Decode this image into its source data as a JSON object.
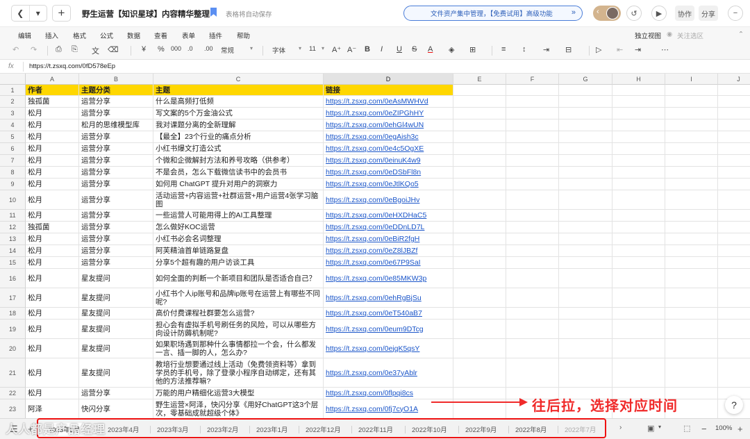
{
  "titlebar": {
    "title": "野生运营【知识星球】内容精华整理",
    "autosave": "表格将自动保存",
    "promo": "文件资产集中管理，【免费试用】高级功能",
    "collab_label": "协作",
    "share_label": "分享",
    "back_icon": "chevron-left-icon",
    "history_icon": "history-icon",
    "play_icon": "play-icon"
  },
  "menu": {
    "items": [
      "编辑",
      "插入",
      "格式",
      "公式",
      "数据",
      "查看",
      "表单",
      "插件",
      "帮助"
    ],
    "view_label": "独立视图",
    "follow_label": "关注选区"
  },
  "toolbar": {
    "number_format": "常规",
    "font_name": "字体",
    "font_size": "11"
  },
  "formula": {
    "fx_label": "fx",
    "value": "https://t.zsxq.com/0fD578eEp"
  },
  "columns": [
    "A",
    "B",
    "C",
    "D",
    "E",
    "F",
    "G",
    "H",
    "I",
    "J"
  ],
  "table": {
    "rows": [
      {
        "n": "1",
        "a": "作者",
        "b": "主题分类",
        "c": "主题",
        "d": "链接"
      },
      {
        "n": "2",
        "a": "独孤菌",
        "b": "运营分享",
        "c": "什么是高频打低频",
        "d": "https://t.zsxq.com/0eAsMWHVd"
      },
      {
        "n": "3",
        "a": "松月",
        "b": "运营分享",
        "c": "写文案的5个万金油公式",
        "d": "https://t.zsxq.com/0eZIPGhHY"
      },
      {
        "n": "4",
        "a": "松月",
        "b": "松月的思维模型库",
        "c": "我对课题分离的全新理解",
        "d": "https://t.zsxq.com/0ehGl4wUN"
      },
      {
        "n": "5",
        "a": "松月",
        "b": "运营分享",
        "c": "【最全】23个行业的痛点分析",
        "d": "https://t.zsxq.com/0egAish3c"
      },
      {
        "n": "6",
        "a": "松月",
        "b": "运营分享",
        "c": "小红书爆文打造公式",
        "d": "https://t.zsxq.com/0e4c5OgXE"
      },
      {
        "n": "7",
        "a": "松月",
        "b": "运营分享",
        "c": "个微和企微解封方法和养号攻略（供参考）",
        "d": "https://t.zsxq.com/0einuK4w9"
      },
      {
        "n": "8",
        "a": "松月",
        "b": "运营分享",
        "c": "不是会员，怎么下载微信读书中的会员书",
        "d": "https://t.zsxq.com/0eDSbFl8n"
      },
      {
        "n": "9",
        "a": "松月",
        "b": "运营分享",
        "c": "如何用 ChatGPT 提升对用户的洞察力",
        "d": "https://t.zsxq.com/0eJtlKQo5"
      },
      {
        "n": "10",
        "a": "松月",
        "b": "运营分享",
        "c": "活动运营+内容运营+社群运营+用户运营4张学习脑图",
        "d": "https://t.zsxq.com/0eBgoiJHv"
      },
      {
        "n": "11",
        "a": "松月",
        "b": "运营分享",
        "c": "一些运营人可能用得上的AI工具整理",
        "d": "https://t.zsxq.com/0eHXDHaC5"
      },
      {
        "n": "12",
        "a": "独孤菌",
        "b": "运营分享",
        "c": "怎么做好KOC运营",
        "d": "https://t.zsxq.com/0eDDnLD7L"
      },
      {
        "n": "13",
        "a": "松月",
        "b": "运营分享",
        "c": "小红书必会名词整理",
        "d": "https://t.zsxq.com/0eBiR2fgH"
      },
      {
        "n": "14",
        "a": "松月",
        "b": "运营分享",
        "c": "阿芙精油首单链路复盘",
        "d": "https://t.zsxq.com/0eZ8lJBZf"
      },
      {
        "n": "15",
        "a": "松月",
        "b": "运营分享",
        "c": "分享5个超有趣的用户访谈工具",
        "d": "https://t.zsxq.com/0e67P9SaI"
      },
      {
        "n": "16",
        "a": "松月",
        "b": "星友提问",
        "c": "如何全面的判断一个新项目和团队是否适合自己？",
        "d": "https://t.zsxq.com/0e85MKW3p"
      },
      {
        "n": "17",
        "a": "松月",
        "b": "星友提问",
        "c": "小红书个人ip账号和品牌ip账号在运营上有哪些不同呢?",
        "d": "https://t.zsxq.com/0ehRgBjSu"
      },
      {
        "n": "18",
        "a": "松月",
        "b": "星友提问",
        "c": "高价付费课程社群要怎么运营?",
        "d": "https://t.zsxq.com/0eT540aB7"
      },
      {
        "n": "19",
        "a": "松月",
        "b": "星友提问",
        "c": "担心会有虚拟手机号刷任务的风险，可以从哪些方向设计防薅机制呢?",
        "d": "https://t.zsxq.com/0eum9DTcg"
      },
      {
        "n": "20",
        "a": "松月",
        "b": "星友提问",
        "c": "如果职场遇到那种什么事情都拉一个会，什么都发一言、插一脚的人，怎么办?",
        "d": "https://t.zsxq.com/0ejqK5qsY"
      },
      {
        "n": "21",
        "a": "松月",
        "b": "星友提问",
        "c": "教培行业想要通过线上活动（免费领资料等）拿到学员的手机号，除了登录小程序自动绑定，还有其他的方法推荐嘛?",
        "d": "https://t.zsxq.com/0e37yAblr"
      },
      {
        "n": "22",
        "a": "松月",
        "b": "运营分享",
        "c": "万能的用户精细化运营3大模型",
        "d": "https://t.zsxq.com/0flpqi8cs"
      },
      {
        "n": "23",
        "a": "阿泽",
        "b": "快闪分享",
        "c": "野生运营×阿泽，快闪分享《用好ChatGPT这3个层次，零基础成就超级个体》",
        "d": "https://t.zsxq.com/0fj7cyO1A"
      }
    ]
  },
  "annotation": {
    "text": "往后拉，选择对应时间"
  },
  "sheets": {
    "active": "2023年5月",
    "tabs": [
      "2023年4月",
      "2023年3月",
      "2023年2月",
      "2023年1月",
      "2022年12月",
      "2022年11月",
      "2022年10月",
      "2022年9月",
      "2022年8月",
      "2022年7月"
    ],
    "zoom": "100%"
  },
  "watermark": "人人都是产品经理",
  "colors": {
    "header_fill": "#ffd700",
    "link": "#1a55c9",
    "annotation": "#f02a2a"
  }
}
